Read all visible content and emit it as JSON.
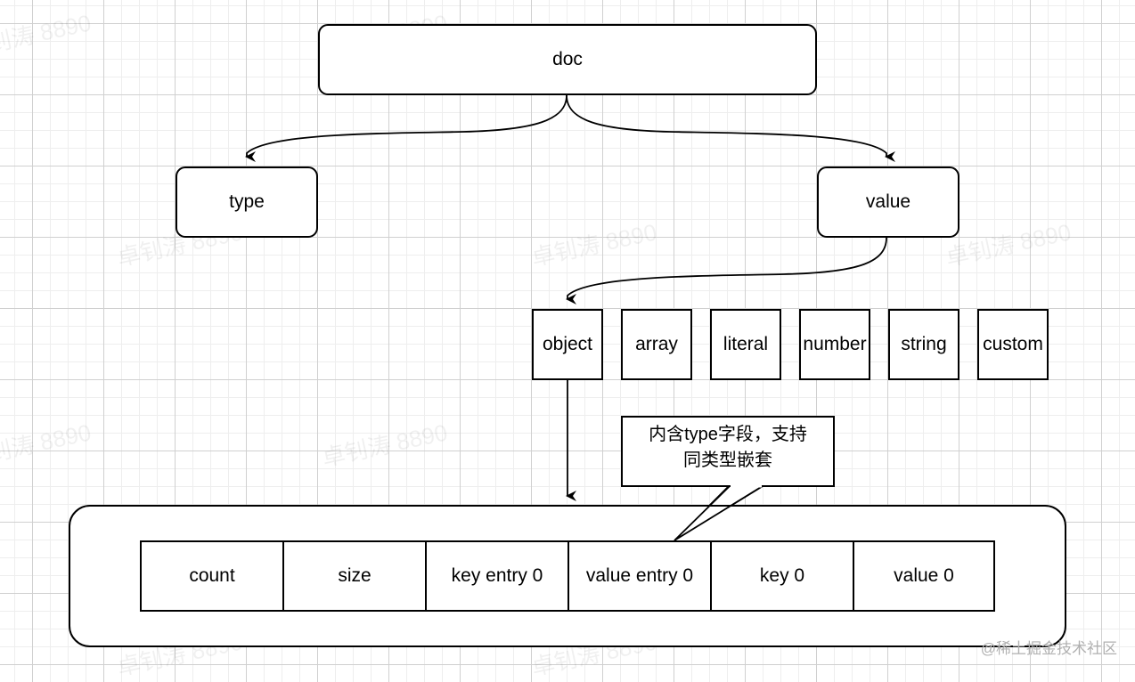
{
  "diagram": {
    "root": {
      "label": "doc"
    },
    "children": [
      {
        "label": "type"
      },
      {
        "label": "value"
      }
    ],
    "value_types": [
      {
        "label": "object"
      },
      {
        "label": "array"
      },
      {
        "label": "literal"
      },
      {
        "label": "number"
      },
      {
        "label": "string"
      },
      {
        "label": "custom"
      }
    ],
    "object_layout": [
      {
        "label": "count"
      },
      {
        "label": "size"
      },
      {
        "label": "key entry 0"
      },
      {
        "label": "value entry 0"
      },
      {
        "label": "key 0"
      },
      {
        "label": "value 0"
      }
    ],
    "callout": {
      "line1": "内含type字段，支持",
      "line2": "同类型嵌套"
    }
  },
  "watermark": "卓钊涛 8890",
  "credit": "@稀土掘金技术社区",
  "colors": {
    "stroke": "#000000",
    "grid_major": "#d0d0d0",
    "grid_minor": "#eeeeee"
  }
}
